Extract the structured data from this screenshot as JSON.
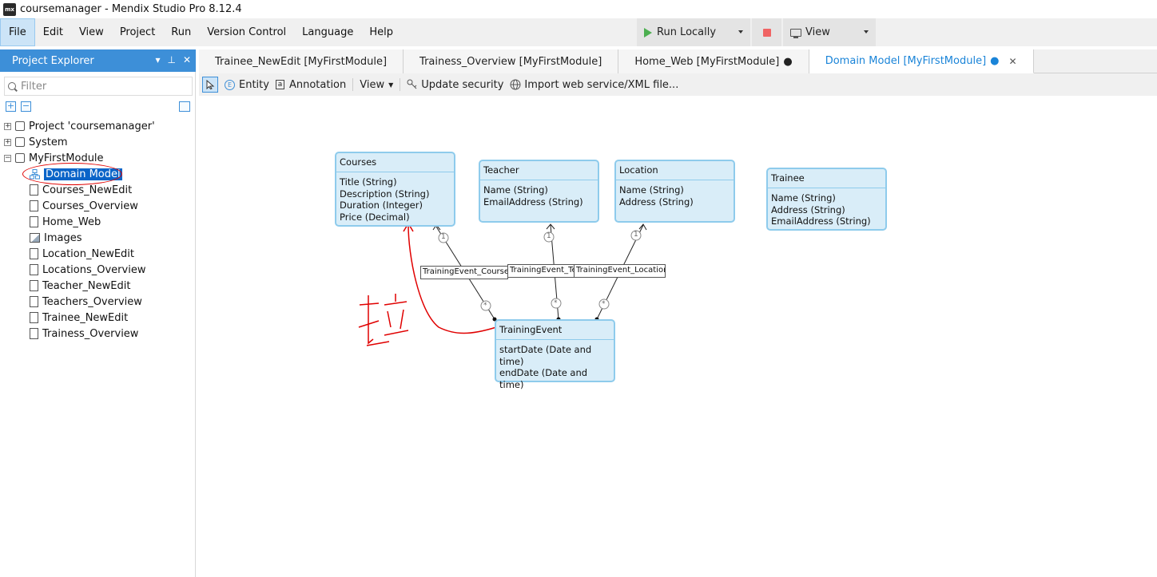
{
  "window": {
    "logo_text": "mx",
    "title": "coursemanager - Mendix Studio Pro 8.12.4"
  },
  "menu": {
    "items": [
      {
        "label": "File",
        "active": true
      },
      {
        "label": "Edit"
      },
      {
        "label": "View"
      },
      {
        "label": "Project"
      },
      {
        "label": "Run"
      },
      {
        "label": "Version Control"
      },
      {
        "label": "Language"
      },
      {
        "label": "Help"
      }
    ],
    "run_label": "Run Locally",
    "view_label": "View"
  },
  "project_explorer": {
    "title": "Project Explorer",
    "filter_placeholder": "Filter",
    "tree": {
      "project": "Project 'coursemanager'",
      "system": "System",
      "module": "MyFirstModule",
      "children": [
        "Domain Model",
        "Courses_NewEdit",
        "Courses_Overview",
        "Home_Web",
        "Images",
        "Location_NewEdit",
        "Locations_Overview",
        "Teacher_NewEdit",
        "Teachers_Overview",
        "Trainee_NewEdit",
        "Trainess_Overview"
      ]
    }
  },
  "tabs": [
    {
      "label": "Trainee_NewEdit [MyFirstModule]"
    },
    {
      "label": "Trainess_Overview [MyFirstModule]"
    },
    {
      "label": "Home_Web [MyFirstModule]",
      "dot": "●"
    },
    {
      "label": "Domain Model [MyFirstModule]",
      "dot": "●",
      "active": true
    }
  ],
  "toolbar": {
    "entity": "Entity",
    "annotation": "Annotation",
    "view": "View",
    "update_security": "Update security",
    "import_ws": "Import web service/XML file..."
  },
  "entities": {
    "courses": {
      "name": "Courses",
      "attrs": [
        "Title (String)",
        "Description (String)",
        "Duration (Integer)",
        "Price (Decimal)"
      ]
    },
    "teacher": {
      "name": "Teacher",
      "attrs": [
        "Name (String)",
        "EmailAddress (String)"
      ]
    },
    "location": {
      "name": "Location",
      "attrs": [
        "Name (String)",
        "Address (String)"
      ]
    },
    "trainee": {
      "name": "Trainee",
      "attrs": [
        "Name (String)",
        "Address (String)",
        "EmailAddress (String)"
      ]
    },
    "training_event": {
      "name": "TrainingEvent",
      "attrs": [
        "startDate (Date and time)",
        "endDate (Date and time)"
      ]
    }
  },
  "associations": {
    "courses": "TrainingEvent_Courses",
    "teacher": "TrainingEvent_Teacher",
    "location": "TrainingEvent_Location",
    "one": "1",
    "many": "*"
  },
  "colors": {
    "accent": "#3d8fd8",
    "entity_fill": "#d9edf8",
    "entity_border": "#8ecbec",
    "annotation_red": "#e00000"
  }
}
